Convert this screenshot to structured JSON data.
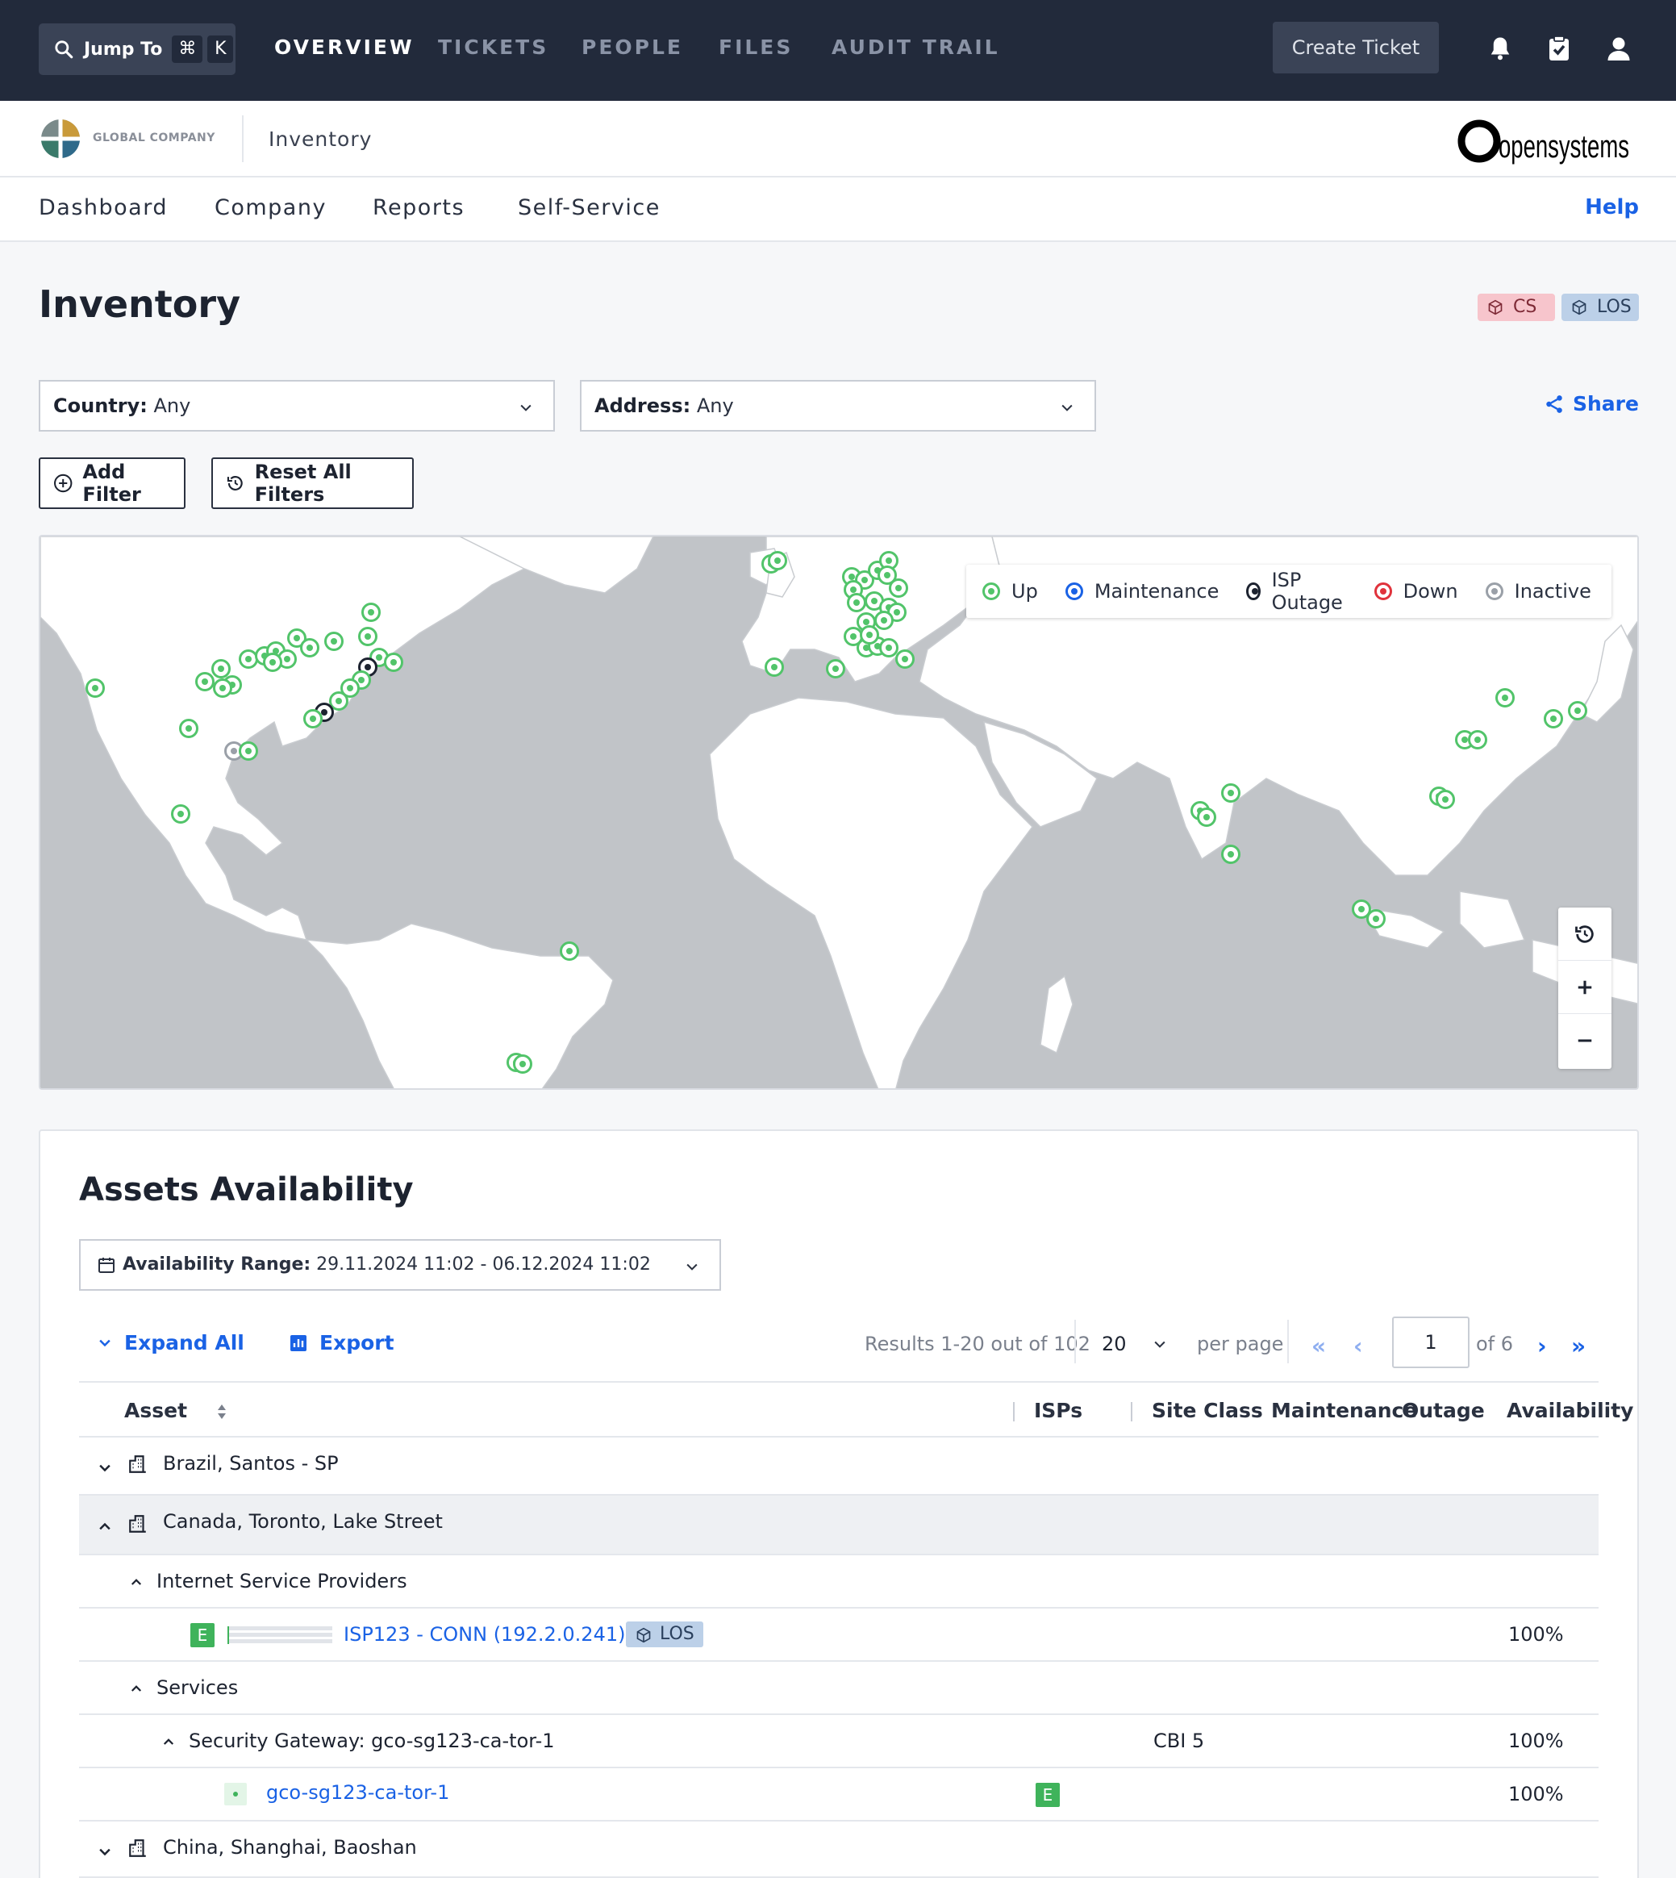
{
  "topbar": {
    "jump_label": "Jump To",
    "kbd_cmd": "⌘",
    "kbd_key": "K",
    "tabs": [
      "OVERVIEW",
      "TICKETS",
      "PEOPLE",
      "FILES",
      "AUDIT TRAIL"
    ],
    "active_tab": "OVERVIEW",
    "create_ticket": "Create Ticket",
    "icons": [
      "bell-icon",
      "clipboard-check-icon",
      "user-icon"
    ]
  },
  "brand": {
    "company_name": "GLOBAL COMPANY",
    "section": "Inventory",
    "vendor_logo": "opensystems"
  },
  "subnav": {
    "items": [
      "Dashboard",
      "Company",
      "Reports",
      "Self-Service"
    ],
    "help": "Help"
  },
  "page": {
    "title": "Inventory",
    "tags": [
      "CS",
      "LOS"
    ]
  },
  "filters": {
    "country_label": "Country:",
    "country_value": "Any",
    "address_label": "Address:",
    "address_value": "Any",
    "share": "Share",
    "add_filter": "Add Filter",
    "reset_filters": "Reset All Filters"
  },
  "map": {
    "legend": [
      {
        "label": "Up",
        "color": "#52c46a"
      },
      {
        "label": "Maintenance",
        "color": "#1a62e5"
      },
      {
        "label": "ISP Outage",
        "color": "#1d2330"
      },
      {
        "label": "Down",
        "color": "#e0333c"
      },
      {
        "label": "Inactive",
        "color": "#9aa0a8"
      }
    ],
    "controls": [
      "reset-view-icon",
      "zoom-in-icon",
      "zoom-out-icon"
    ]
  },
  "assets": {
    "title": "Assets Availability",
    "range_label": "Availability Range:",
    "range_value": "29.11.2024 11:02 - 06.12.2024 11:02",
    "expand_all": "Expand All",
    "export": "Export",
    "results": "Results 1-20 out of 102",
    "per_page_value": "20",
    "per_page_label": "per page",
    "page_current": "1",
    "page_of": "of 6",
    "columns": [
      "Asset",
      "ISPs",
      "Site Class",
      "Maintenance",
      "Outage",
      "Availability"
    ],
    "rows": {
      "brazil": "Brazil, Santos - SP",
      "canada": "Canada, Toronto, Lake Street",
      "isp_group": "Internet Service Providers",
      "isp_badge": "E",
      "isp_name": "ISP123 - CONN (192.2.0.241)",
      "isp_tag": "LOS",
      "isp_avail": "100%",
      "services_group": "Services",
      "gateway": "Security Gateway: gco-sg123-ca-tor-1",
      "gateway_class": "CBI 5",
      "gateway_avail": "100%",
      "service_name": "gco-sg123-ca-tor-1",
      "service_badge": "E",
      "service_avail": "100%",
      "china": "China, Shanghai, Baoshan"
    }
  },
  "colors": {
    "topbar_bg": "#222a3b",
    "accent": "#1a62e5",
    "up_green": "#52c46a"
  }
}
